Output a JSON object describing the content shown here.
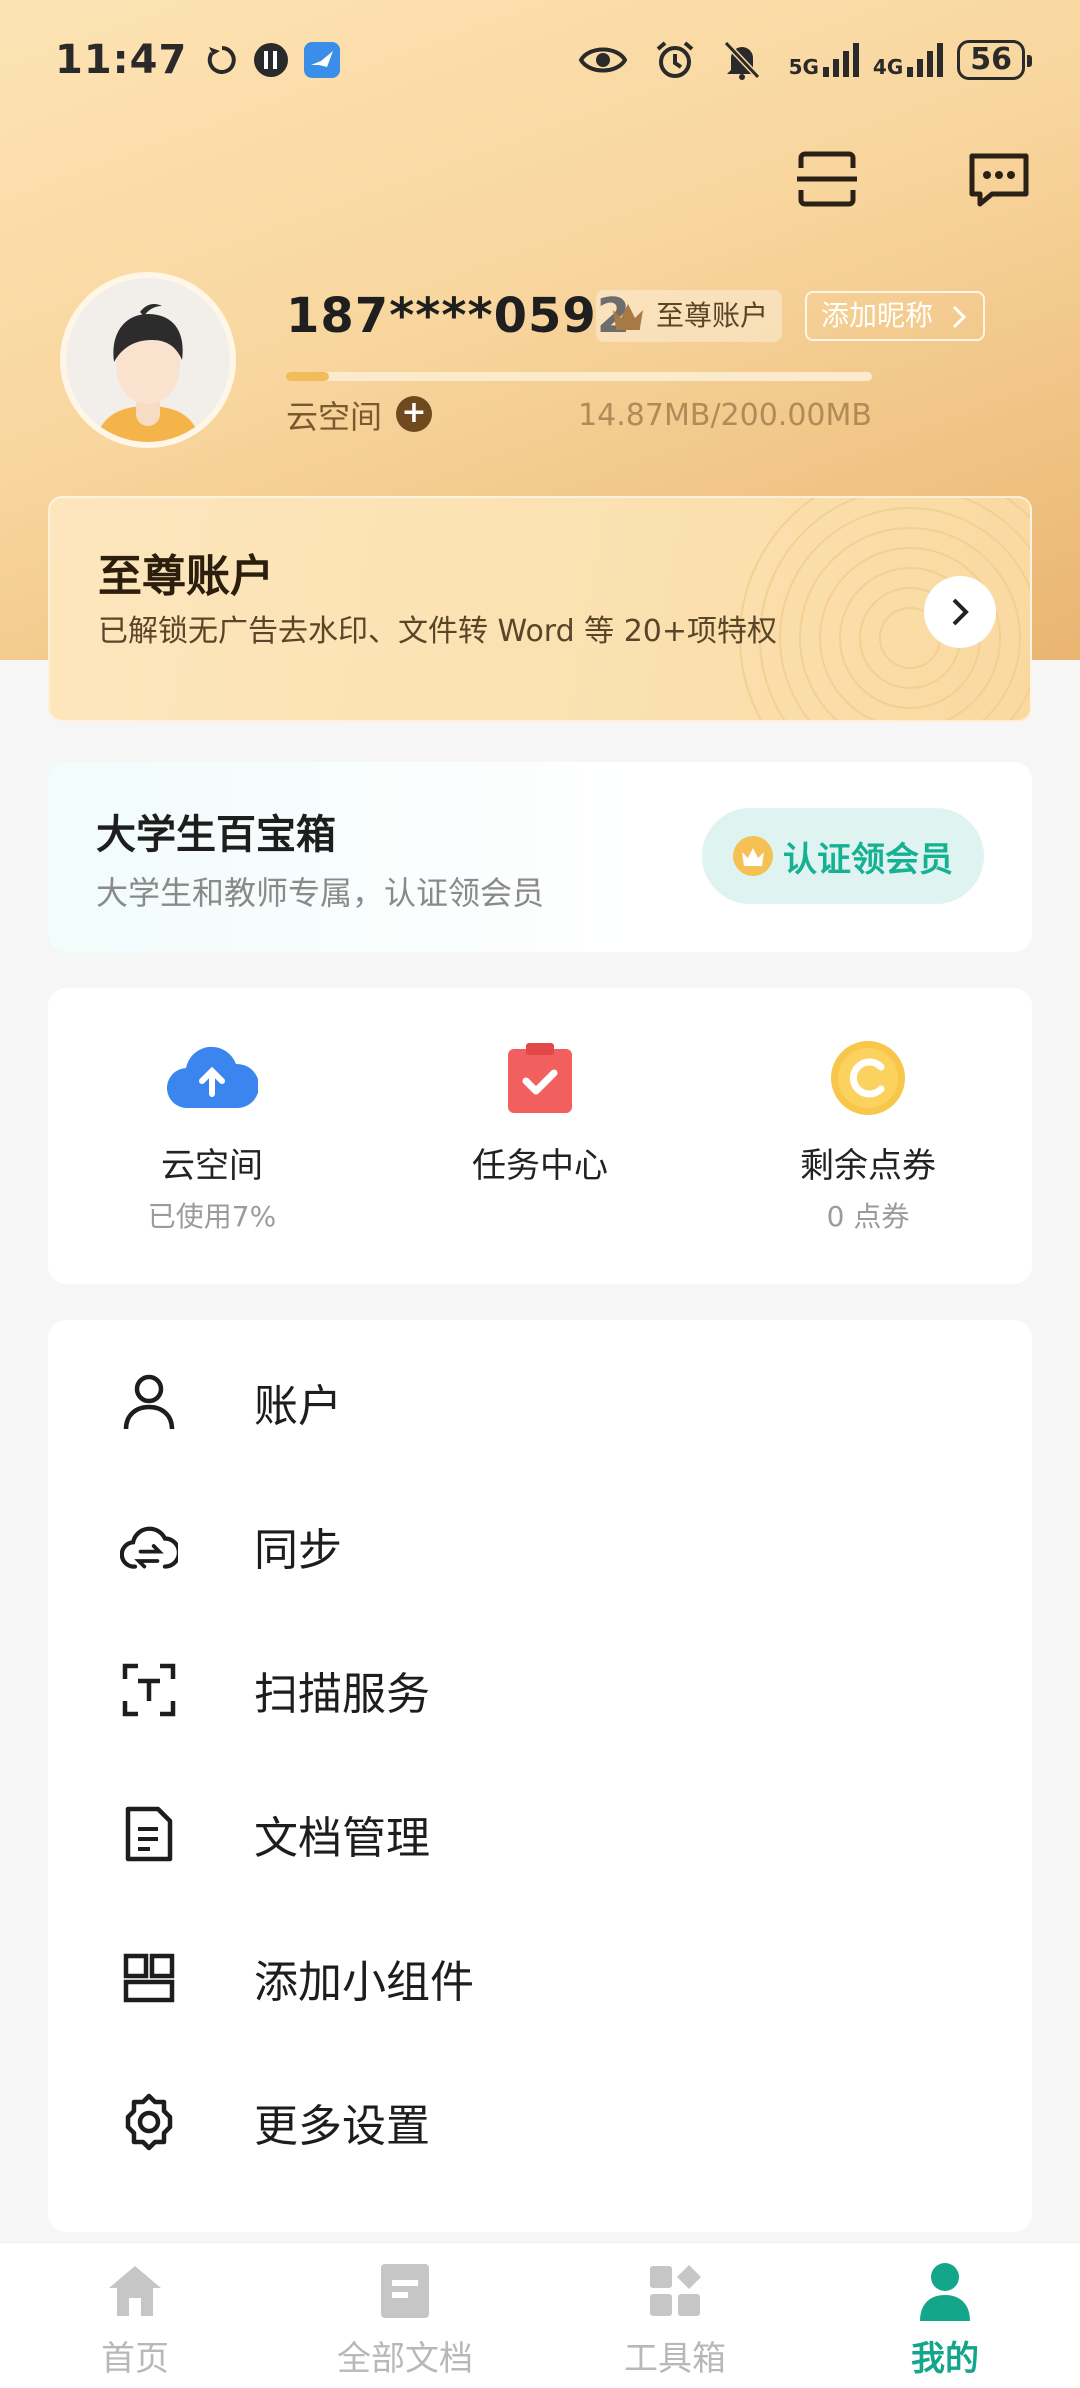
{
  "status_bar": {
    "time": "11:47",
    "net1": "5G",
    "net2": "4G",
    "battery": "56"
  },
  "profile": {
    "phone": "187****0592",
    "tier_badge": "至尊账户",
    "nickname_button": "添加昵称",
    "storage_label": "云空间",
    "storage_value": "14.87MB/200.00MB",
    "storage_used_fraction": 0.074
  },
  "premium_card": {
    "title": "至尊账户",
    "description": "已解锁无广告去水印、文件转 Word 等 20+项特权"
  },
  "student_card": {
    "title": "大学生百宝箱",
    "description": "大学生和教师专属，认证领会员",
    "button": "认证领会员"
  },
  "stats": [
    {
      "label": "云空间",
      "sub": "已使用7%",
      "icon": "cloud-upload-icon"
    },
    {
      "label": "任务中心",
      "sub": "",
      "icon": "task-check-icon"
    },
    {
      "label": "剩余点券",
      "sub": "0 点券",
      "icon": "coin-icon"
    }
  ],
  "menu": [
    {
      "label": "账户",
      "icon": "user-icon"
    },
    {
      "label": "同步",
      "icon": "cloud-sync-icon"
    },
    {
      "label": "扫描服务",
      "icon": "scan-text-icon"
    },
    {
      "label": "文档管理",
      "icon": "document-icon"
    },
    {
      "label": "添加小组件",
      "icon": "widget-icon"
    },
    {
      "label": "更多设置",
      "icon": "gear-icon"
    }
  ],
  "bottom_nav": [
    {
      "label": "首页",
      "icon": "home-icon"
    },
    {
      "label": "全部文档",
      "icon": "documents-icon"
    },
    {
      "label": "工具箱",
      "icon": "toolbox-icon"
    },
    {
      "label": "我的",
      "icon": "profile-icon",
      "active": true
    }
  ],
  "colors": {
    "accent": "#13a68a",
    "gold": "#eab571"
  }
}
